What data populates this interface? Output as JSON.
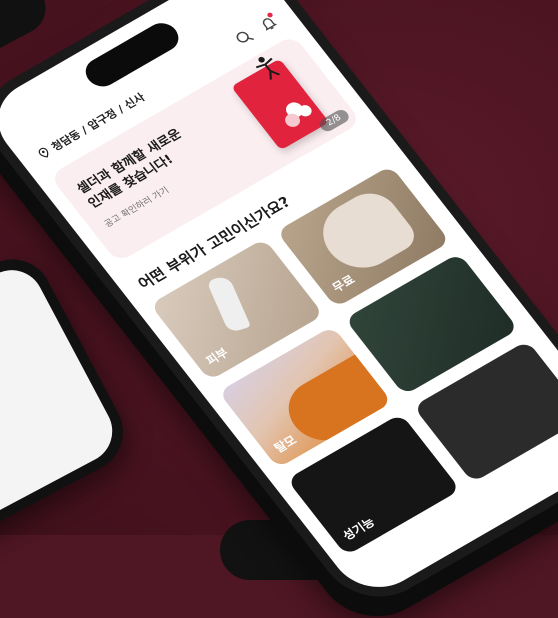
{
  "location": {
    "text": "청담동 / 압구정 / 신사"
  },
  "banner": {
    "title": "셀더과 함께할 새로운\n인재를 찾습니다!",
    "subtitle": "공고 확인하러 가기",
    "page_indicator": "2/8"
  },
  "section": {
    "title": "어떤 부위가 고민이신가요?"
  },
  "categories": [
    {
      "label": "피부"
    },
    {
      "label": "무료"
    },
    {
      "label": "탈모"
    },
    {
      "label": ""
    },
    {
      "label": "성기능"
    },
    {
      "label": ""
    }
  ],
  "colors": {
    "background": "#4f1623",
    "accent": "#e2233e",
    "banner_bg": "#fbeef0"
  },
  "icons": {
    "location": "pin-icon",
    "search": "search-icon",
    "notification": "bell-icon"
  }
}
